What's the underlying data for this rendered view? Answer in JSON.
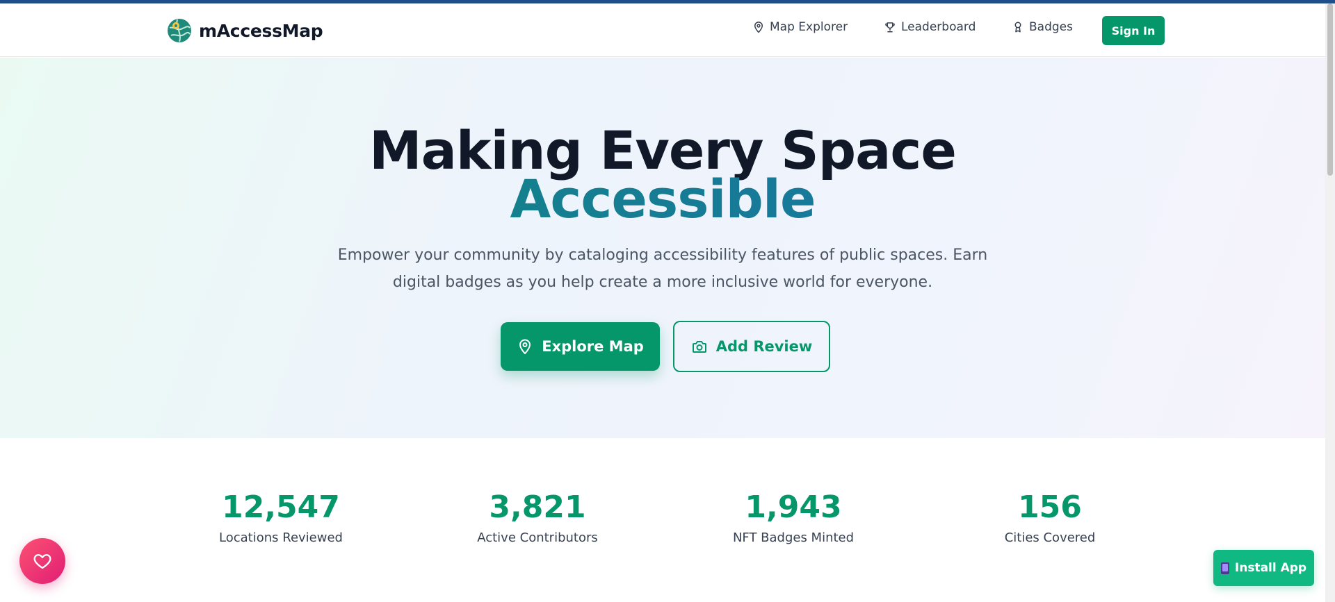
{
  "header": {
    "logo_text": "mAccessMap",
    "nav": [
      {
        "label": "Map Explorer",
        "icon": "map-pin-icon"
      },
      {
        "label": "Leaderboard",
        "icon": "trophy-icon"
      },
      {
        "label": "Badges",
        "icon": "award-icon"
      }
    ],
    "sign_in_label": "Sign In"
  },
  "hero": {
    "headline_line1": "Making Every Space",
    "headline_line2": "Accessible",
    "subtitle": "Empower your community by cataloging accessibility features of public spaces. Earn digital badges as you help create a more inclusive world for everyone.",
    "primary_button": {
      "label": "Explore Map",
      "icon": "map-pin-icon"
    },
    "secondary_button": {
      "label": "Add Review",
      "icon": "camera-icon"
    }
  },
  "stats": [
    {
      "value": "12,547",
      "label": "Locations Reviewed"
    },
    {
      "value": "3,821",
      "label": "Active Contributors"
    },
    {
      "value": "1,943",
      "label": "NFT Badges Minted"
    },
    {
      "value": "156",
      "label": "Cities Covered"
    }
  ],
  "floating": {
    "favorite_icon": "heart-icon",
    "install_label": "Install App",
    "install_icon": "mobile-phone-icon"
  },
  "colors": {
    "brand_green": "#059669",
    "accent_blue": "#1f7fb0",
    "install_green": "#10b981",
    "fab_pink": "#e11d74",
    "top_strip": "#1e4e8c"
  }
}
